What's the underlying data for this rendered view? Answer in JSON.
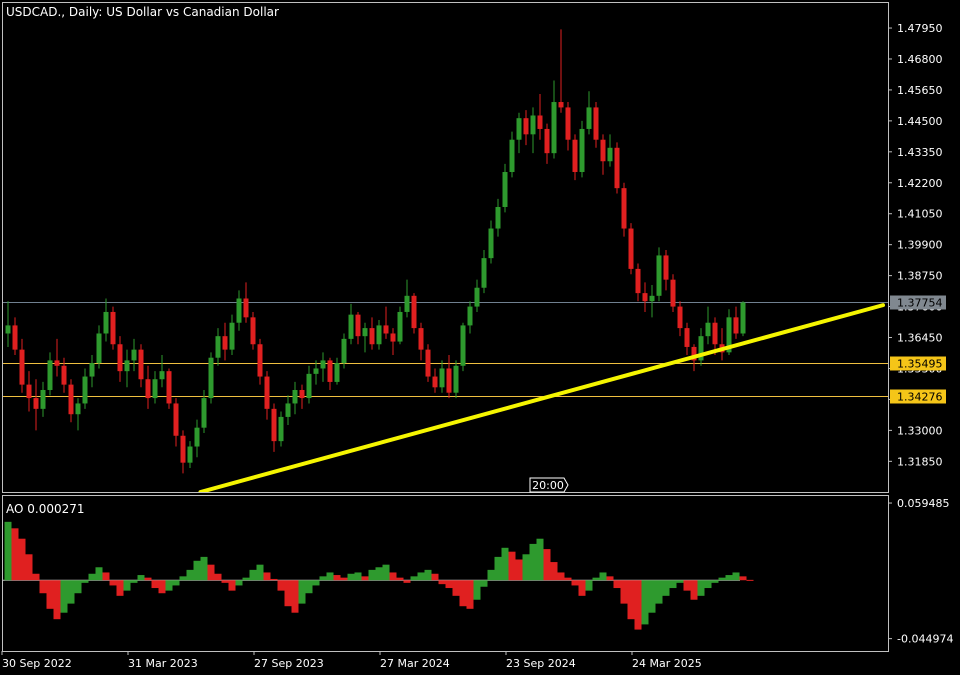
{
  "header": {
    "symbol_title": "USDCAD., Daily:  US Dollar vs Canadian Dollar",
    "indicator_title": "AO 0.000271"
  },
  "colors": {
    "background": "#000000",
    "frame": "#c0c0c0",
    "bull": "#2e9a2e",
    "bear": "#e02020",
    "trendline": "#f5f500",
    "level_line": "#f0c040",
    "current_line": "#708090",
    "level_label": "#f5c518",
    "current_label": "#808890"
  },
  "chart_data": [
    {
      "type": "candlestick",
      "symbol": "USDCAD.",
      "timeframe": "Daily",
      "y_axis_ticks": [
        "1.47950",
        "1.46800",
        "1.45650",
        "1.44500",
        "1.43350",
        "1.42200",
        "1.41050",
        "1.39900",
        "1.38750",
        "1.37600",
        "1.36450",
        "1.35300",
        "1.34150",
        "1.33000",
        "1.31850"
      ],
      "y_visible_range": [
        1.3071,
        1.4888
      ],
      "x_axis_labels": [
        "30 Sep 2022",
        "31 Mar 2023",
        "27 Sep 2023",
        "27 Mar 2024",
        "23 Sep 2024",
        "24 Mar 2025"
      ],
      "x_axis_label_index": [
        0,
        18,
        36,
        54,
        72,
        90
      ],
      "time_marker": "20:00",
      "time_marker_index": 74,
      "horizontal_lines": [
        {
          "label": "1.37754",
          "value": 1.37754,
          "kind": "current"
        },
        {
          "label": "1.35495",
          "value": 1.35495,
          "kind": "level"
        },
        {
          "label": "1.34276",
          "value": 1.34276,
          "kind": "level"
        }
      ],
      "trendline": {
        "from": [
          55,
          1.3071
        ],
        "to": [
          250,
          1.37654
        ],
        "unit": "index_vs_price"
      },
      "bars": [
        [
          1.366,
          1.378,
          1.361,
          1.369
        ],
        [
          1.369,
          1.372,
          1.358,
          1.36
        ],
        [
          1.36,
          1.364,
          1.344,
          1.347
        ],
        [
          1.347,
          1.352,
          1.337,
          1.342
        ],
        [
          1.342,
          1.349,
          1.33,
          1.338
        ],
        [
          1.338,
          1.348,
          1.335,
          1.345
        ],
        [
          1.345,
          1.359,
          1.343,
          1.356
        ],
        [
          1.356,
          1.364,
          1.35,
          1.354
        ],
        [
          1.354,
          1.357,
          1.344,
          1.347
        ],
        [
          1.347,
          1.349,
          1.333,
          1.336
        ],
        [
          1.336,
          1.342,
          1.33,
          1.34
        ],
        [
          1.34,
          1.353,
          1.338,
          1.35
        ],
        [
          1.35,
          1.358,
          1.346,
          1.355
        ],
        [
          1.355,
          1.369,
          1.353,
          1.366
        ],
        [
          1.366,
          1.379,
          1.363,
          1.374
        ],
        [
          1.374,
          1.376,
          1.36,
          1.362
        ],
        [
          1.362,
          1.365,
          1.348,
          1.352
        ],
        [
          1.352,
          1.36,
          1.346,
          1.356
        ],
        [
          1.356,
          1.364,
          1.352,
          1.36
        ],
        [
          1.36,
          1.362,
          1.346,
          1.349
        ],
        [
          1.349,
          1.354,
          1.338,
          1.342
        ],
        [
          1.342,
          1.352,
          1.34,
          1.349
        ],
        [
          1.349,
          1.358,
          1.346,
          1.352
        ],
        [
          1.352,
          1.353,
          1.338,
          1.34
        ],
        [
          1.34,
          1.342,
          1.324,
          1.328
        ],
        [
          1.328,
          1.33,
          1.314,
          1.318
        ],
        [
          1.318,
          1.326,
          1.316,
          1.324
        ],
        [
          1.324,
          1.334,
          1.32,
          1.331
        ],
        [
          1.331,
          1.345,
          1.329,
          1.342
        ],
        [
          1.342,
          1.359,
          1.34,
          1.357
        ],
        [
          1.357,
          1.368,
          1.354,
          1.365
        ],
        [
          1.365,
          1.37,
          1.356,
          1.36
        ],
        [
          1.36,
          1.373,
          1.358,
          1.37
        ],
        [
          1.37,
          1.382,
          1.367,
          1.379
        ],
        [
          1.379,
          1.385,
          1.37,
          1.372
        ],
        [
          1.372,
          1.374,
          1.36,
          1.362
        ],
        [
          1.362,
          1.364,
          1.347,
          1.35
        ],
        [
          1.35,
          1.352,
          1.334,
          1.338
        ],
        [
          1.338,
          1.34,
          1.322,
          1.326
        ],
        [
          1.326,
          1.337,
          1.324,
          1.335
        ],
        [
          1.335,
          1.343,
          1.332,
          1.34
        ],
        [
          1.34,
          1.348,
          1.336,
          1.345
        ],
        [
          1.345,
          1.347,
          1.338,
          1.342
        ],
        [
          1.342,
          1.354,
          1.34,
          1.351
        ],
        [
          1.351,
          1.356,
          1.347,
          1.353
        ],
        [
          1.353,
          1.359,
          1.348,
          1.356
        ],
        [
          1.356,
          1.357,
          1.345,
          1.348
        ],
        [
          1.348,
          1.357,
          1.347,
          1.355
        ],
        [
          1.355,
          1.366,
          1.353,
          1.364
        ],
        [
          1.364,
          1.377,
          1.362,
          1.373
        ],
        [
          1.373,
          1.374,
          1.362,
          1.365
        ],
        [
          1.365,
          1.37,
          1.359,
          1.368
        ],
        [
          1.368,
          1.372,
          1.36,
          1.362
        ],
        [
          1.362,
          1.371,
          1.36,
          1.369
        ],
        [
          1.369,
          1.376,
          1.364,
          1.366
        ],
        [
          1.366,
          1.368,
          1.358,
          1.363
        ],
        [
          1.363,
          1.376,
          1.362,
          1.374
        ],
        [
          1.374,
          1.386,
          1.372,
          1.38
        ],
        [
          1.38,
          1.381,
          1.366,
          1.368
        ],
        [
          1.368,
          1.37,
          1.356,
          1.36
        ],
        [
          1.36,
          1.362,
          1.348,
          1.35
        ],
        [
          1.35,
          1.353,
          1.344,
          1.346
        ],
        [
          1.346,
          1.356,
          1.344,
          1.353
        ],
        [
          1.353,
          1.358,
          1.342,
          1.344
        ],
        [
          1.344,
          1.356,
          1.342,
          1.354
        ],
        [
          1.354,
          1.37,
          1.352,
          1.369
        ],
        [
          1.369,
          1.378,
          1.366,
          1.376
        ],
        [
          1.376,
          1.386,
          1.374,
          1.383
        ],
        [
          1.383,
          1.397,
          1.381,
          1.394
        ],
        [
          1.394,
          1.408,
          1.392,
          1.405
        ],
        [
          1.405,
          1.416,
          1.402,
          1.413
        ],
        [
          1.413,
          1.429,
          1.411,
          1.426
        ],
        [
          1.426,
          1.441,
          1.424,
          1.438
        ],
        [
          1.438,
          1.448,
          1.433,
          1.446
        ],
        [
          1.446,
          1.449,
          1.436,
          1.44
        ],
        [
          1.44,
          1.45,
          1.433,
          1.447
        ],
        [
          1.447,
          1.455,
          1.438,
          1.442
        ],
        [
          1.442,
          1.444,
          1.429,
          1.433
        ],
        [
          1.433,
          1.46,
          1.431,
          1.452
        ],
        [
          1.452,
          1.479,
          1.448,
          1.45
        ],
        [
          1.45,
          1.452,
          1.434,
          1.438
        ],
        [
          1.438,
          1.44,
          1.423,
          1.426
        ],
        [
          1.426,
          1.445,
          1.424,
          1.442
        ],
        [
          1.442,
          1.456,
          1.44,
          1.45
        ],
        [
          1.45,
          1.452,
          1.435,
          1.438
        ],
        [
          1.438,
          1.44,
          1.425,
          1.43
        ],
        [
          1.43,
          1.44,
          1.428,
          1.435
        ],
        [
          1.435,
          1.437,
          1.418,
          1.42
        ],
        [
          1.42,
          1.422,
          1.402,
          1.405
        ],
        [
          1.405,
          1.407,
          1.388,
          1.39
        ],
        [
          1.39,
          1.392,
          1.378,
          1.381
        ],
        [
          1.381,
          1.385,
          1.374,
          1.378
        ],
        [
          1.378,
          1.384,
          1.372,
          1.38
        ],
        [
          1.38,
          1.398,
          1.378,
          1.395
        ],
        [
          1.395,
          1.397,
          1.382,
          1.386
        ],
        [
          1.386,
          1.388,
          1.374,
          1.376
        ],
        [
          1.376,
          1.378,
          1.365,
          1.368
        ],
        [
          1.368,
          1.37,
          1.358,
          1.361
        ],
        [
          1.361,
          1.362,
          1.352,
          1.356
        ],
        [
          1.356,
          1.368,
          1.354,
          1.365
        ],
        [
          1.365,
          1.376,
          1.362,
          1.37
        ],
        [
          1.37,
          1.372,
          1.358,
          1.362
        ],
        [
          1.362,
          1.368,
          1.356,
          1.359
        ],
        [
          1.359,
          1.375,
          1.358,
          1.372
        ],
        [
          1.372,
          1.376,
          1.364,
          1.366
        ],
        [
          1.366,
          1.378,
          1.365,
          1.3775
        ]
      ]
    },
    {
      "type": "histogram",
      "name": "AO",
      "current_value": 0.000271,
      "y_axis_ticks": [
        "0.059485",
        "-0.044974"
      ],
      "y_visible_range": [
        -0.0545,
        0.0649
      ],
      "values": [
        0.045,
        0.04,
        0.032,
        0.02,
        0.005,
        -0.01,
        -0.022,
        -0.03,
        -0.025,
        -0.018,
        -0.01,
        -0.002,
        0.005,
        0.01,
        0.006,
        -0.004,
        -0.012,
        -0.008,
        -0.002,
        0.004,
        0.002,
        -0.006,
        -0.01,
        -0.008,
        -0.004,
        0.003,
        0.008,
        0.015,
        0.018,
        0.012,
        0.005,
        -0.002,
        -0.008,
        -0.004,
        0.002,
        0.008,
        0.012,
        0.006,
        0.001,
        -0.008,
        -0.02,
        -0.025,
        -0.018,
        -0.01,
        -0.004,
        0.003,
        0.006,
        0.004,
        0.002,
        0.005,
        0.006,
        0.003,
        0.008,
        0.01,
        0.012,
        0.006,
        0.002,
        -0.002,
        0.003,
        0.006,
        0.008,
        0.005,
        -0.003,
        -0.006,
        -0.012,
        -0.02,
        -0.022,
        -0.015,
        -0.005,
        0.008,
        0.018,
        0.025,
        0.022,
        0.016,
        0.02,
        0.028,
        0.032,
        0.024,
        0.014,
        0.006,
        0.002,
        -0.004,
        -0.012,
        -0.008,
        0.002,
        0.006,
        0.003,
        -0.006,
        -0.018,
        -0.03,
        -0.038,
        -0.034,
        -0.025,
        -0.018,
        -0.012,
        -0.006,
        -0.002,
        -0.008,
        -0.015,
        -0.012,
        -0.006,
        -0.002,
        0.002,
        0.004,
        0.006,
        0.003,
        0.0003
      ]
    }
  ]
}
